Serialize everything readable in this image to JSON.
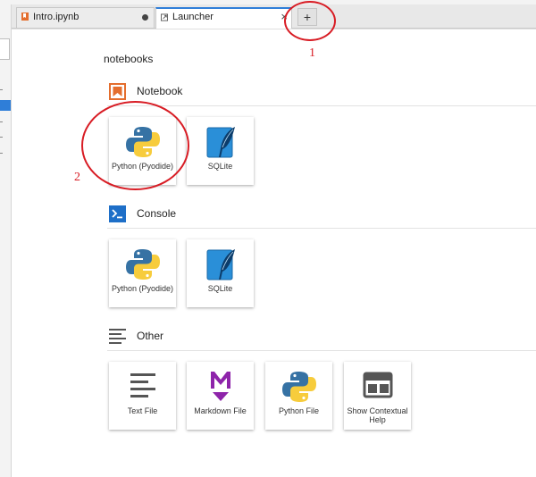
{
  "tabs": [
    {
      "label": "Intro.ipynb",
      "state": "modified"
    },
    {
      "label": "Launcher",
      "state": "active"
    }
  ],
  "add_tab_label": "+",
  "close_glyph": "×",
  "launcher": {
    "title": "notebooks",
    "sections": [
      {
        "label": "Notebook",
        "icon": "notebook-bookmark-icon",
        "items": [
          {
            "label": "Python (Pyodide)",
            "icon": "python-logo-icon"
          },
          {
            "label": "SQLite",
            "icon": "sqlite-feather-icon"
          }
        ]
      },
      {
        "label": "Console",
        "icon": "console-prompt-icon",
        "items": [
          {
            "label": "Python (Pyodide)",
            "icon": "python-logo-icon"
          },
          {
            "label": "SQLite",
            "icon": "sqlite-feather-icon"
          }
        ]
      },
      {
        "label": "Other",
        "icon": "other-lines-icon",
        "items": [
          {
            "label": "Text File",
            "icon": "text-file-icon"
          },
          {
            "label": "Markdown File",
            "icon": "markdown-icon"
          },
          {
            "label": "Python File",
            "icon": "python-logo-icon"
          },
          {
            "label": "Show Contextual Help",
            "icon": "contextual-help-icon"
          }
        ]
      }
    ]
  },
  "annotations": [
    {
      "number": "1",
      "target": "add-tab-button"
    },
    {
      "number": "2",
      "target": "python-pyodide-notebook-card"
    }
  ],
  "colors": {
    "accent": "#2f7ed8",
    "annotation": "#d81c24",
    "notebook": "#e46e2e",
    "python_blue": "#3672a4",
    "python_yellow": "#f7cc3c",
    "markdown": "#8e24aa"
  }
}
